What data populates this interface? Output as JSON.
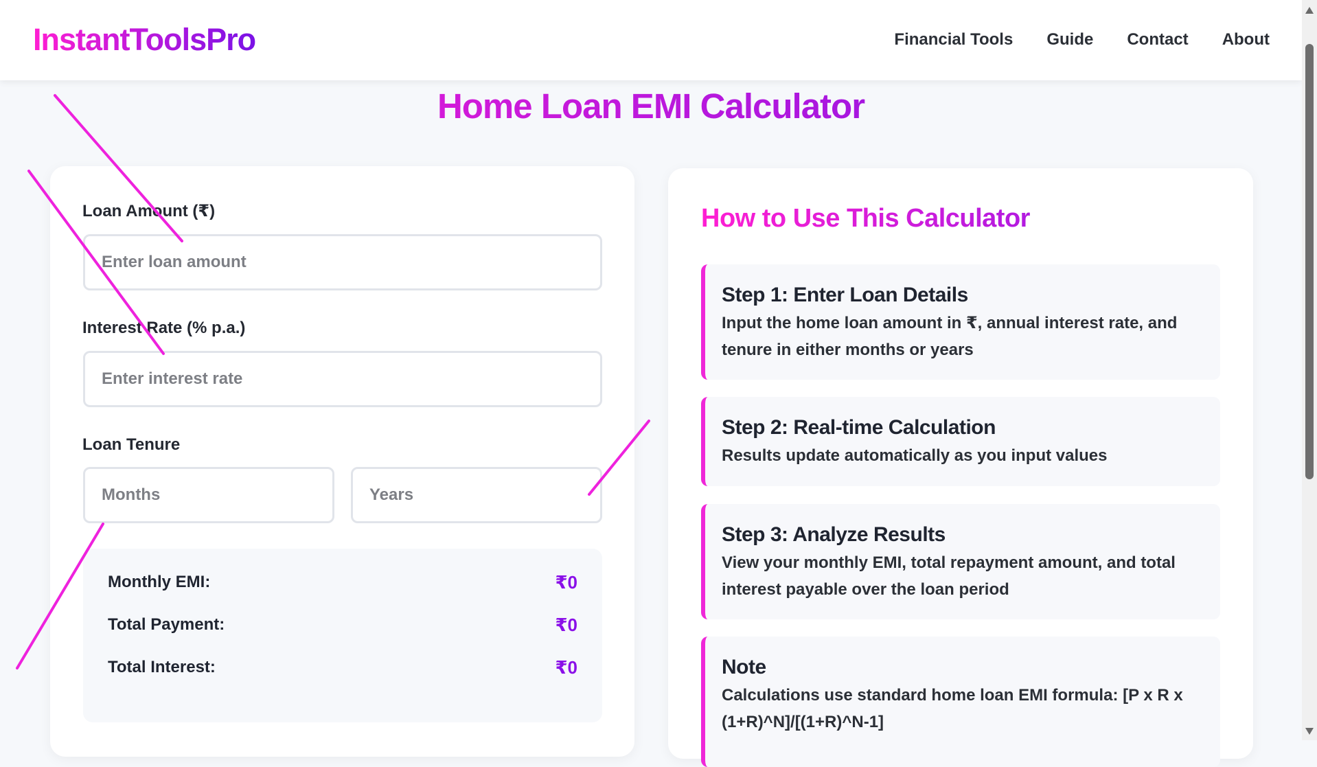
{
  "brand": {
    "logo": "InstantToolsPro"
  },
  "nav": {
    "items": [
      "Financial Tools",
      "Guide",
      "Contact",
      "About"
    ]
  },
  "page": {
    "title": "Home Loan EMI Calculator"
  },
  "calculator": {
    "loan_amount": {
      "label": "Loan Amount (₹)",
      "placeholder": "Enter loan amount",
      "value": ""
    },
    "interest_rate": {
      "label": "Interest Rate (% p.a.)",
      "placeholder": "Enter interest rate",
      "value": ""
    },
    "tenure": {
      "label": "Loan Tenure",
      "months_placeholder": "Months",
      "years_placeholder": "Years"
    },
    "results": {
      "monthly_emi": {
        "label": "Monthly EMI:",
        "value": "₹0"
      },
      "total_payment": {
        "label": "Total Payment:",
        "value": "₹0"
      },
      "total_interest": {
        "label": "Total Interest:",
        "value": "₹0"
      }
    }
  },
  "guide": {
    "title": "How to Use This Calculator",
    "steps": [
      {
        "title": "Step 1: Enter Loan Details",
        "text": "Input the home loan amount in ₹, annual interest rate, and tenure in either months or years"
      },
      {
        "title": "Step 2: Real-time Calculation",
        "text": "Results update automatically as you input values"
      },
      {
        "title": "Step 3: Analyze Results",
        "text": "View your monthly EMI, total repayment amount, and total interest payable over the loan period"
      },
      {
        "title": "Note",
        "text": "Calculations use standard home loan EMI formula: [P x R x (1+R)^N]/[(1+R)^N-1]"
      }
    ]
  },
  "colors": {
    "brand_gradient_start": "#ff1fd2",
    "brand_gradient_end": "#7a12e6",
    "result_value": "#8a10e8",
    "step_accent": "#ef27d8",
    "annotation_stroke": "#ee22dd"
  }
}
